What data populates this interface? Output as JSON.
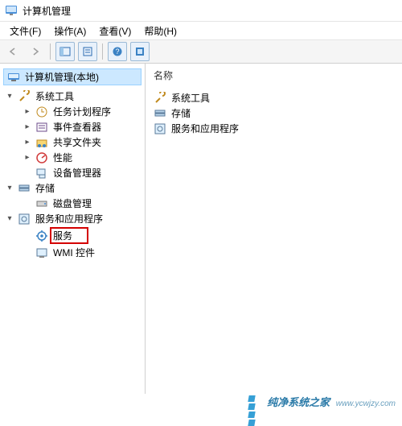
{
  "window": {
    "title": "计算机管理"
  },
  "menubar": {
    "file": "文件(F)",
    "action": "操作(A)",
    "view": "查看(V)",
    "help": "帮助(H)"
  },
  "tree": {
    "root": "计算机管理(本地)",
    "systools": "系统工具",
    "tasksched": "任务计划程序",
    "eventvwr": "事件查看器",
    "sharedf": "共享文件夹",
    "perf": "性能",
    "devmgr": "设备管理器",
    "storage": "存储",
    "diskmgmt": "磁盘管理",
    "svcapps": "服务和应用程序",
    "services": "服务",
    "wmi": "WMI 控件"
  },
  "list": {
    "header": "名称",
    "items": [
      "系统工具",
      "存储",
      "服务和应用程序"
    ]
  },
  "watermark": {
    "text": "纯净系统之家",
    "url": "www.ycwjzy.com"
  }
}
